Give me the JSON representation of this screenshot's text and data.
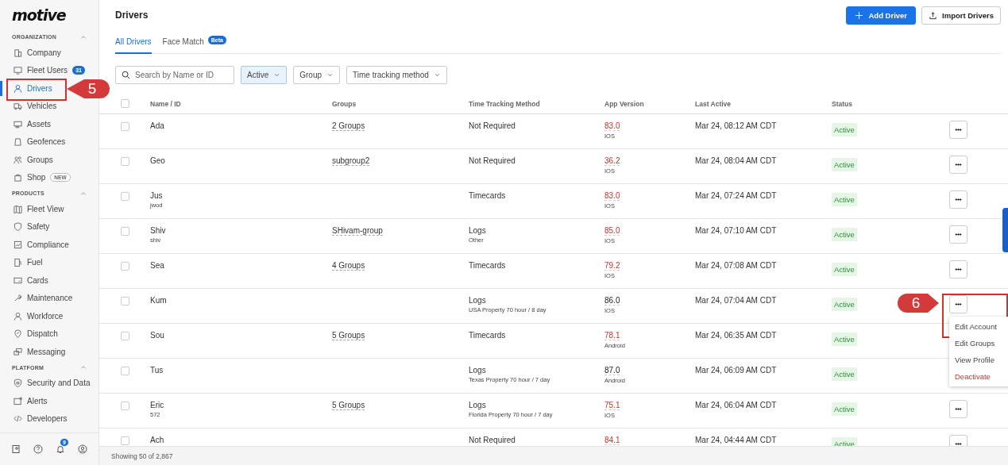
{
  "logo": "motive",
  "sidebar": {
    "sections": [
      {
        "title": "ORGANIZATION",
        "expanded": true,
        "items": [
          {
            "label": "Company",
            "selected": false
          },
          {
            "label": "Fleet Users",
            "selected": false,
            "badge": "31"
          },
          {
            "label": "Drivers",
            "selected": true
          },
          {
            "label": "Vehicles",
            "selected": false
          },
          {
            "label": "Assets",
            "selected": false
          },
          {
            "label": "Geofences",
            "selected": false
          },
          {
            "label": "Groups",
            "selected": false
          },
          {
            "label": "Shop",
            "selected": false,
            "tag": "NEW"
          }
        ]
      },
      {
        "title": "PRODUCTS",
        "expanded": true,
        "items": [
          {
            "label": "Fleet View",
            "selected": false
          },
          {
            "label": "Safety",
            "selected": false
          },
          {
            "label": "Compliance",
            "selected": false
          },
          {
            "label": "Fuel",
            "selected": false
          },
          {
            "label": "Cards",
            "selected": false
          },
          {
            "label": "Maintenance",
            "selected": false
          },
          {
            "label": "Workforce",
            "selected": false
          },
          {
            "label": "Dispatch",
            "selected": false
          },
          {
            "label": "Messaging",
            "selected": false
          }
        ]
      },
      {
        "title": "PLATFORM",
        "expanded": true,
        "items": [
          {
            "label": "Security and Data",
            "selected": false
          },
          {
            "label": "Alerts",
            "selected": false
          },
          {
            "label": "Developers",
            "selected": false
          }
        ]
      }
    ],
    "footer": {
      "notification_count": "9"
    }
  },
  "page": {
    "title": "Drivers",
    "buttons": [
      {
        "label": "Add Driver",
        "kind": "primary"
      },
      {
        "label": "Import Drivers",
        "kind": "secondary"
      }
    ],
    "tabs": [
      {
        "label": "All Drivers",
        "selected": true
      },
      {
        "label": "Face Match",
        "selected": false,
        "badge": "Beta"
      }
    ],
    "filters": {
      "search": {
        "placeholder": "Search by Name or ID"
      },
      "dropdowns": [
        {
          "label": "Active",
          "selected": true
        },
        {
          "label": "Group",
          "selected": false
        },
        {
          "label": "Time tracking method",
          "selected": false
        }
      ]
    }
  },
  "table": {
    "select_all": {
      "checked": false
    },
    "columns": [
      "Name / ID",
      "Groups",
      "Time Tracking Method",
      "App Version",
      "Last Active",
      "Status"
    ],
    "rows": [
      {
        "checked": false,
        "name": "Ada",
        "groups": "2 Groups",
        "method": "Not Required",
        "version": "83.0",
        "outdated": true,
        "platform": "IOS",
        "last_active": "Mar 24, 08:12 AM CDT",
        "status": "Active"
      },
      {
        "checked": false,
        "name": "Geo",
        "groups": "subgroup2",
        "method": "Not Required",
        "version": "36.2",
        "outdated": true,
        "platform": "IOS",
        "last_active": "Mar 24, 08:04 AM CDT",
        "status": "Active"
      },
      {
        "checked": false,
        "name": "Jus",
        "name_sub": "jwod",
        "method": "Timecards",
        "version": "83.0",
        "outdated": true,
        "platform": "IOS",
        "last_active": "Mar 24, 07:24 AM CDT",
        "status": "Active"
      },
      {
        "checked": false,
        "name": "Shiv",
        "name_sub": "shiv",
        "groups": "SHivam-group",
        "method": "Logs",
        "method_sub": "Other",
        "version": "85.0",
        "outdated": true,
        "platform": "IOS",
        "last_active": "Mar 24, 07:10 AM CDT",
        "status": "Active"
      },
      {
        "checked": false,
        "name": "Sea",
        "groups": "4 Groups",
        "method": "Timecards",
        "version": "79.2",
        "outdated": true,
        "platform": "IOS",
        "last_active": "Mar 24, 07:08 AM CDT",
        "status": "Active"
      },
      {
        "checked": false,
        "name": "Kum",
        "method": "Logs",
        "method_sub": "USA Property 70 hour / 8 day",
        "version": "86.0",
        "outdated": false,
        "platform": "IOS",
        "last_active": "Mar 24, 07:04 AM CDT",
        "status": "Active",
        "menu": [
          {
            "label": "Edit Account",
            "kind": "normal"
          },
          {
            "label": "Edit Groups",
            "kind": "normal"
          },
          {
            "label": "View Profile",
            "kind": "normal"
          },
          {
            "label": "Deactivate",
            "kind": "danger"
          }
        ]
      },
      {
        "checked": false,
        "name": "Sou",
        "groups": "5 Groups",
        "method": "Timecards",
        "version": "78.1",
        "outdated": true,
        "platform": "Android",
        "last_active": "Mar 24, 06:35 AM CDT",
        "status": "Active"
      },
      {
        "checked": false,
        "name": "Tus",
        "method": "Logs",
        "method_sub": "Texas Property 70 hour / 7 day",
        "version": "87.0",
        "outdated": false,
        "platform": "Android",
        "last_active": "Mar 24, 06:09 AM CDT",
        "status": "Active"
      },
      {
        "checked": false,
        "name": "Eric",
        "name_sub": "572",
        "groups": "5 Groups",
        "method": "Logs",
        "method_sub": "Florida Property 70 hour / 7 day",
        "version": "75.1",
        "outdated": true,
        "platform": "IOS",
        "last_active": "Mar 24, 06:04 AM CDT",
        "status": "Active"
      },
      {
        "checked": false,
        "name": "Ach",
        "method": "Not Required",
        "version": "84.1",
        "outdated": true,
        "last_active": "Mar 24, 04:44 AM CDT",
        "status": "Active"
      }
    ]
  },
  "footer": {
    "text": "Showing 50 of 2,867"
  },
  "annotations": [
    {
      "label": "5"
    },
    {
      "label": "6"
    }
  ]
}
